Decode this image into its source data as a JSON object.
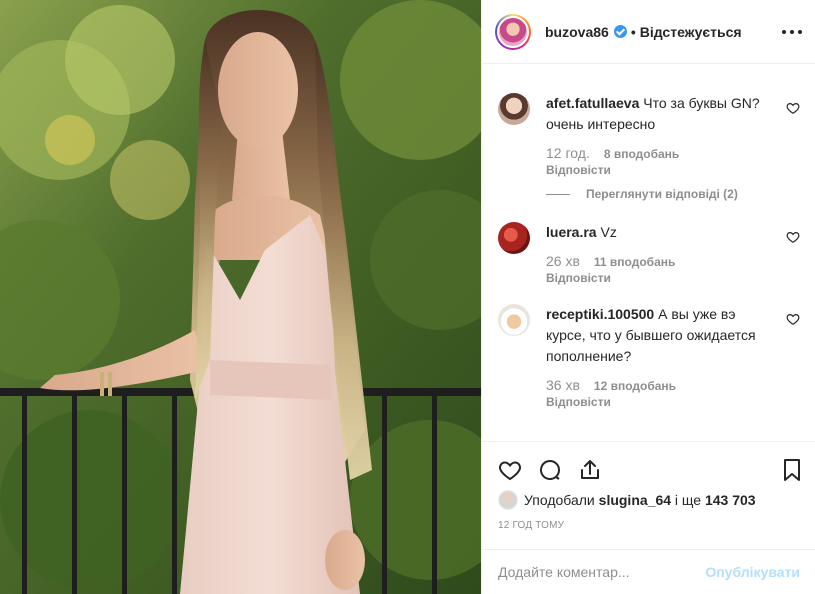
{
  "post": {
    "username": "buzova86",
    "follow_state": "Відстежується",
    "dot": "•"
  },
  "comments": [
    {
      "username": "afet.fatullaeva",
      "text": "Что за буквы GN? очень интересно",
      "time": "12 год.",
      "likes": "8 вподобань",
      "reply": "Відповісти",
      "view_replies": "Переглянути відповіді (2)"
    },
    {
      "username": "luera.ra",
      "text": "Vz",
      "time": "26 хв",
      "likes": "11 вподобань",
      "reply": "Відповісти"
    },
    {
      "username": "receptiki.100500",
      "text": "А вы уже вэ курсе, что у бывшего ожидается пополнение?",
      "time": "36 хв",
      "likes": "12 вподобань",
      "reply": "Відповісти"
    }
  ],
  "likes_line": {
    "prefix": "Уподобали",
    "user": "slugina_64",
    "middle": "і ще",
    "count": "143 703"
  },
  "timestamp": "12 ГОД ТОМУ",
  "add_comment": {
    "placeholder": "Додайте коментар...",
    "publish": "Опублікувати"
  },
  "colors": {
    "link_blue_disabled": "#b2dffc",
    "verified_blue": "#3897f0",
    "muted_gray": "#8e8e8e",
    "text": "#262626"
  },
  "icons": [
    "verified-icon",
    "more-icon",
    "heart-icon",
    "comment-icon",
    "share-icon",
    "bookmark-icon"
  ]
}
